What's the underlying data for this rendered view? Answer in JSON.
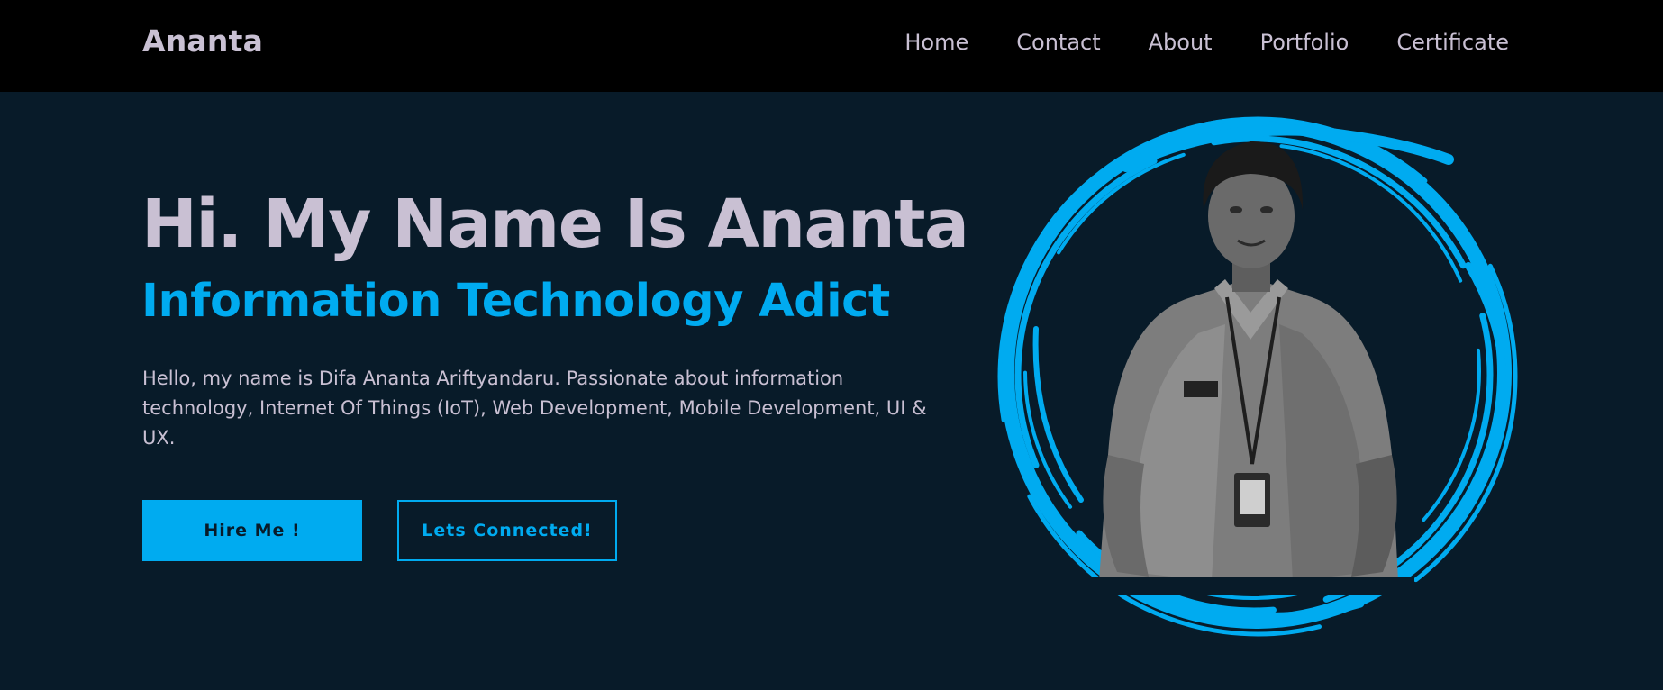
{
  "nav": {
    "logo": "Ananta",
    "links": [
      {
        "label": "Home"
      },
      {
        "label": "Contact"
      },
      {
        "label": "About"
      },
      {
        "label": "Portfolio"
      },
      {
        "label": "Certificate"
      }
    ]
  },
  "hero": {
    "title": "Hi. My Name Is Ananta",
    "subtitle": "Information Technology Adict",
    "description": "Hello, my name is Difa Ananta Ariftyandaru. Passionate about information technology, Internet Of Things (IoT), Web Development, Mobile Development, UI & UX.",
    "buttons": {
      "hire": "Hire Me !",
      "connect": "Lets Connected!"
    }
  },
  "colors": {
    "accent": "#00abf0",
    "background": "#081b29",
    "navbar": "#000000",
    "text": "#c9c0d3"
  }
}
